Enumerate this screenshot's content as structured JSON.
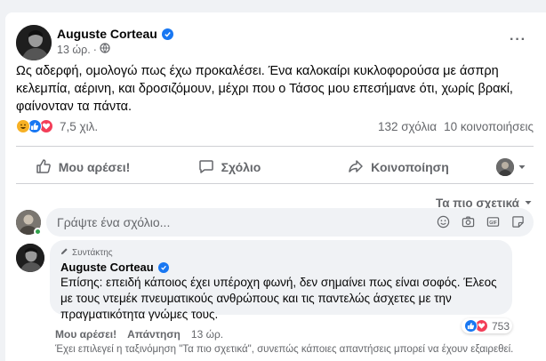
{
  "post": {
    "author": "Auguste Corteau",
    "time": "13 ώρ.",
    "more": "···",
    "text": "Ως αδερφή, ομολογώ πως έχω προκαλέσει. Ένα καλοκαίρι κυκλοφορούσα με άσπρη κελεμπία, αέρινη, και δροσιζόμουν, μέχρι που ο Τάσος μου επεσήμανε ότι, χωρίς βρακί, φαίνονταν τα πάντα.",
    "reaction_count": "7,5 χιλ.",
    "comments_count": "132 σχόλια",
    "shares_count": "10 κοινοποιήσεις"
  },
  "actions": {
    "like": "Μου αρέσει!",
    "comment": "Σχόλιο",
    "share": "Κοινοποίηση"
  },
  "sort": {
    "label": "Τα πιο σχετικά"
  },
  "composer": {
    "placeholder": "Γράψτε ένα σχόλιο..."
  },
  "comment": {
    "role": "Συντάκτης",
    "author": "Auguste Corteau",
    "text": "Επίσης: επειδή κάποιος έχει υπέροχη φωνή, δεν σημαίνει πως είναι σοφός. Έλεος με τους ντεμέκ πνευματικούς ανθρώπους και τις παντελώς άσχετες με την πραγματικότητα γνώμες τους.",
    "reaction_count": "753",
    "like": "Μου αρέσει!",
    "reply": "Απάντηση",
    "time": "13 ώρ."
  },
  "note": "Έχει επιλεγεί η ταξινόμηση \"Τα πιο σχετικά\", συνεπώς κάποιες απαντήσεις μπορεί να έχουν εξαιρεθεί.",
  "colors": {
    "accent": "#1877f2",
    "love": "#f33e58",
    "haha": "#f7b125",
    "text_secondary": "#65676b"
  }
}
